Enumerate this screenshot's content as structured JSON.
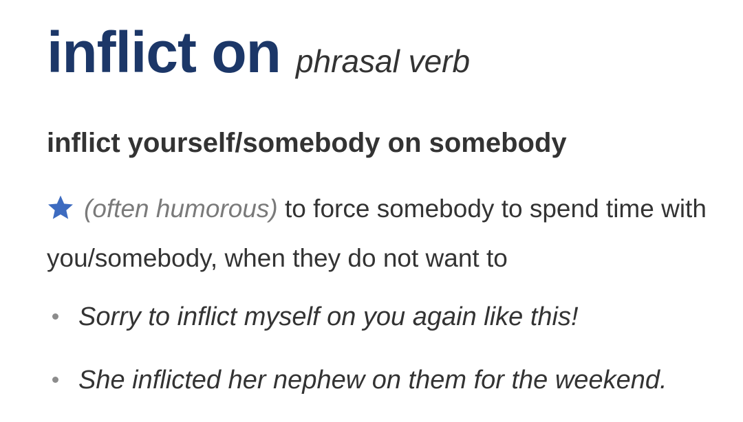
{
  "entry": {
    "headword": "inflict on",
    "part_of_speech": "phrasal verb",
    "idiom": "inflict yourself/somebody on somebody",
    "star_icon": "star-icon",
    "register_label": "(often humorous)",
    "definition": "to force somebody to spend time with you/somebody, when they do not want to",
    "examples": [
      "Sorry to inflict myself on you again like this!",
      "She inflicted her nephew on them for the weekend."
    ]
  },
  "colors": {
    "headword": "#1c3768",
    "star": "#3d6bc0",
    "label": "#7a7a7a",
    "text": "#333333"
  }
}
